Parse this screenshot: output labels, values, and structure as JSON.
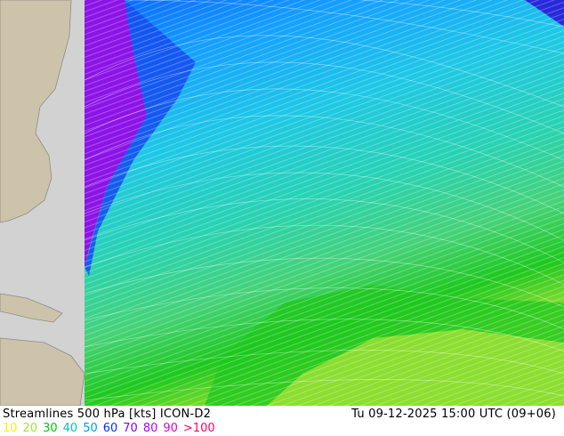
{
  "map": {
    "title": "Streamlines 500 hPa [kts] ICON-D2",
    "datetime": "Tu 09-12-2025 15:00 UTC (09+06)",
    "colors": {
      "sea": "#d2d2d2",
      "land": "#cdc3aa",
      "border": "#8c8c8c"
    }
  },
  "legend": [
    {
      "label": "10",
      "color": "#f5f500"
    },
    {
      "label": "20",
      "color": "#a0e632"
    },
    {
      "label": "30",
      "color": "#00c800"
    },
    {
      "label": "40",
      "color": "#00c8b4"
    },
    {
      "label": "50",
      "color": "#0096ff"
    },
    {
      "label": "60",
      "color": "#0032ff"
    },
    {
      "label": "70",
      "color": "#8000ff"
    },
    {
      "label": "80",
      "color": "#b400ff"
    },
    {
      "label": "90",
      "color": "#dc00dc"
    },
    {
      "label": ">100",
      "color": "#ff0064"
    }
  ]
}
